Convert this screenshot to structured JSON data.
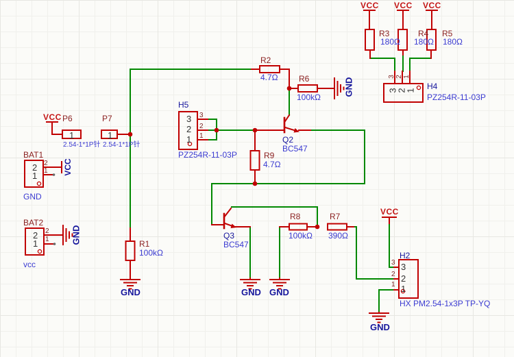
{
  "app": {
    "view": "schematic-canvas"
  },
  "colors": {
    "wire_green": "#008800",
    "symbol_red": "#c00000",
    "designator_red": "#8b2121",
    "designator_navy": "#16169c",
    "value_blue": "#3b3bd1",
    "vcc_text": "#c41616",
    "gnd_text": "#16169c"
  },
  "power": {
    "vcc": "VCC",
    "gnd": "GND"
  },
  "pins": {
    "n1": "1",
    "n2": "2",
    "n3": "3"
  },
  "components": {
    "r1": {
      "ref": "R1",
      "value": "100kΩ"
    },
    "r2": {
      "ref": "R2",
      "value": "4.7Ω"
    },
    "r3": {
      "ref": "R3",
      "value": "180Ω"
    },
    "r4": {
      "ref": "R4",
      "value": "180Ω"
    },
    "r5": {
      "ref": "R5",
      "value": "180Ω"
    },
    "r6": {
      "ref": "R6",
      "value": "100kΩ"
    },
    "r7": {
      "ref": "R7",
      "value": "390Ω"
    },
    "r8": {
      "ref": "R8",
      "value": "100kΩ"
    },
    "r9": {
      "ref": "R9",
      "value": "4.7Ω"
    },
    "q2": {
      "ref": "Q2",
      "value": "BC547"
    },
    "q3": {
      "ref": "Q3",
      "value": "BC547"
    },
    "h2": {
      "ref": "H2",
      "value": "HX PM2.54-1x3P TP-YQ"
    },
    "h4": {
      "ref": "H4",
      "value": "PZ254R-11-03P"
    },
    "h5": {
      "ref": "H5",
      "value": "PZ254R-11-03P"
    },
    "p6": {
      "ref": "P6",
      "value": "2.54-1*1P针"
    },
    "p7": {
      "ref": "P7",
      "value": "2.54-1*1P针"
    },
    "bat1": {
      "ref": "BAT1",
      "value": "GND"
    },
    "bat2": {
      "ref": "BAT2",
      "value": "vcc"
    }
  }
}
